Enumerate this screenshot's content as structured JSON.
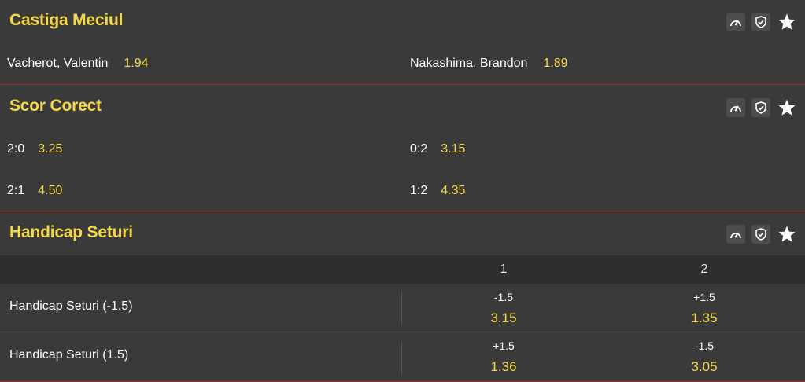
{
  "markets": [
    {
      "title": "Castiga Meciul",
      "selections": [
        {
          "name": "Vacherot, Valentin",
          "odd": "1.94"
        },
        {
          "name": "Nakashima, Brandon",
          "odd": "1.89"
        }
      ]
    },
    {
      "title": "Scor Corect",
      "selections": [
        {
          "name": "2:0",
          "odd": "3.25"
        },
        {
          "name": "0:2",
          "odd": "3.15"
        },
        {
          "name": "2:1",
          "odd": "4.50"
        },
        {
          "name": "1:2",
          "odd": "4.35"
        }
      ]
    },
    {
      "title": "Handicap Seturi",
      "columns": [
        "1",
        "2"
      ],
      "rows": [
        {
          "label": "Handicap Seturi (-1.5)",
          "cells": [
            {
              "line": "-1.5",
              "odd": "3.15"
            },
            {
              "line": "+1.5",
              "odd": "1.35"
            }
          ]
        },
        {
          "label": "Handicap Seturi (1.5)",
          "cells": [
            {
              "line": "+1.5",
              "odd": "1.36"
            },
            {
              "line": "-1.5",
              "odd": "3.05"
            }
          ]
        }
      ]
    }
  ],
  "icons": {
    "stats": "speedometer-icon",
    "cashout": "shield-check-icon",
    "favorite": "star-icon"
  },
  "colors": {
    "background": "#3a3a3a",
    "title": "#f5d84a",
    "odd": "#f5d84a",
    "separator": "#b0282a",
    "column_header_bg": "#2e2e2e"
  }
}
